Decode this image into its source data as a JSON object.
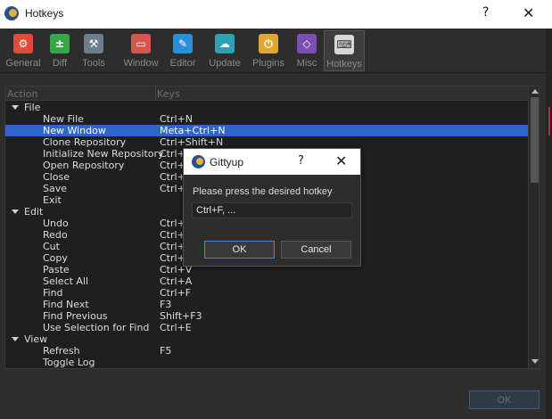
{
  "window": {
    "title": "Hotkeys",
    "help_glyph": "?",
    "close_glyph": "✕"
  },
  "toolbar": [
    {
      "label": "General",
      "icon": "gear-icon",
      "color": "#e04b3a",
      "glyph": "⚙"
    },
    {
      "label": "Diff",
      "icon": "diff-icon",
      "color": "#3aa64a",
      "glyph": "±"
    },
    {
      "label": "Tools",
      "icon": "hammer-icon",
      "color": "#6f7e8f",
      "glyph": "⚒"
    },
    {
      "label": "Window",
      "icon": "window-icon",
      "color": "#d9544f",
      "glyph": "▭"
    },
    {
      "label": "Editor",
      "icon": "pencil-icon",
      "color": "#2c8fd6",
      "glyph": "✎"
    },
    {
      "label": "Update",
      "icon": "cloud-upload-icon",
      "color": "#2aa1b5",
      "glyph": "☁"
    },
    {
      "label": "Plugins",
      "icon": "plug-icon",
      "color": "#e0a72e",
      "glyph": "⏻"
    },
    {
      "label": "Misc",
      "icon": "shapes-icon",
      "color": "#7b4fb3",
      "glyph": "◇"
    },
    {
      "label": "Hotkeys",
      "icon": "keyboard-icon",
      "color": "#d8d8d8",
      "glyph": "⌨"
    }
  ],
  "tree": {
    "header_action": "Action",
    "header_keys": "Keys",
    "rows": [
      {
        "group": true,
        "action": "File",
        "keys": ""
      },
      {
        "group": false,
        "action": "New File",
        "keys": "Ctrl+N"
      },
      {
        "group": false,
        "action": "New Window",
        "keys": "Meta+Ctrl+N",
        "selected": true
      },
      {
        "group": false,
        "action": "Clone Repository",
        "keys": "Ctrl+Shift+N"
      },
      {
        "group": false,
        "action": "Initialize New Repository",
        "keys": "Ctrl+"
      },
      {
        "group": false,
        "action": "Open Repository",
        "keys": "Ctrl+"
      },
      {
        "group": false,
        "action": "Close",
        "keys": "Ctrl+"
      },
      {
        "group": false,
        "action": "Save",
        "keys": "Ctrl+"
      },
      {
        "group": false,
        "action": "Exit",
        "keys": ""
      },
      {
        "group": true,
        "action": "Edit",
        "keys": ""
      },
      {
        "group": false,
        "action": "Undo",
        "keys": "Ctrl+"
      },
      {
        "group": false,
        "action": "Redo",
        "keys": "Ctrl+"
      },
      {
        "group": false,
        "action": "Cut",
        "keys": "Ctrl+"
      },
      {
        "group": false,
        "action": "Copy",
        "keys": "Ctrl+"
      },
      {
        "group": false,
        "action": "Paste",
        "keys": "Ctrl+V"
      },
      {
        "group": false,
        "action": "Select All",
        "keys": "Ctrl+A"
      },
      {
        "group": false,
        "action": "Find",
        "keys": "Ctrl+F"
      },
      {
        "group": false,
        "action": "Find Next",
        "keys": "F3"
      },
      {
        "group": false,
        "action": "Find Previous",
        "keys": "Shift+F3"
      },
      {
        "group": false,
        "action": "Use Selection for Find",
        "keys": "Ctrl+E"
      },
      {
        "group": true,
        "action": "View",
        "keys": ""
      },
      {
        "group": false,
        "action": "Refresh",
        "keys": "F5"
      },
      {
        "group": false,
        "action": "Toggle Log",
        "keys": ""
      }
    ]
  },
  "bottom": {
    "ok_label": "OK"
  },
  "dialog": {
    "title": "Gittyup",
    "help_glyph": "?",
    "close_glyph": "✕",
    "message": "Please press the desired hotkey",
    "field_value": "Ctrl+F, ...",
    "ok_label": "OK",
    "cancel_label": "Cancel"
  },
  "colors": {
    "selection": "#2f65ca",
    "background": "#2d2d2d",
    "tree_background": "#1f1f1f"
  }
}
